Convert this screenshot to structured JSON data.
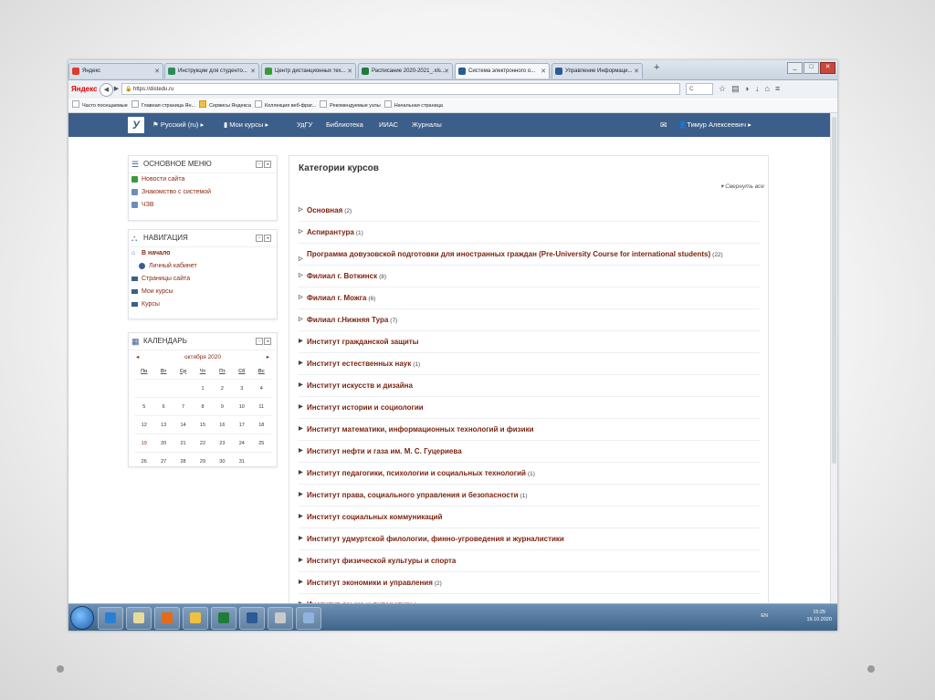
{
  "tabs": [
    {
      "label": "Яндекс",
      "fav_color": "#e03a2b",
      "active": false
    },
    {
      "label": "Инструкции для студенто...",
      "fav_color": "#2e8b57",
      "active": false
    },
    {
      "label": "Центр дистанционных тех...",
      "fav_color": "#3a9a3a",
      "active": false
    },
    {
      "label": "Расписание 2020-2021_.xls...",
      "fav_color": "#1e7d3a",
      "active": false
    },
    {
      "label": "Система электронного о...",
      "fav_color": "#2b5a95",
      "active": true
    },
    {
      "label": "Управление Информаци...",
      "fav_color": "#2b5a95",
      "active": false
    }
  ],
  "address": {
    "brand": "Яндекс",
    "url": "https://distedu.ru",
    "search_placeholder": "С"
  },
  "bookmarks": [
    {
      "label": "Часто посещаемые",
      "folder": false
    },
    {
      "label": "Главная страница Ян...",
      "folder": false
    },
    {
      "label": "Сервисы Яндекса",
      "folder": true
    },
    {
      "label": "Коллекция веб-фраг...",
      "folder": false
    },
    {
      "label": "Рекомендуемые узлы",
      "folder": false
    },
    {
      "label": "Начальная страница",
      "folder": false
    }
  ],
  "topnav": {
    "logo": "У",
    "language": "Русский (ru)",
    "my_courses": "Мои курсы",
    "links": [
      "УдГУ",
      "Библиотека",
      "ИИАС",
      "Журналы"
    ],
    "user": "Тимур Алексеевич"
  },
  "main_menu": {
    "title": "ОСНОВНОЕ МЕНЮ",
    "items": [
      "Новости сайта",
      "Знакомство с системой",
      "ЧЗВ"
    ]
  },
  "navigation": {
    "title": "НАВИГАЦИЯ",
    "items": [
      {
        "label": "В начало",
        "bold": true
      },
      {
        "label": "Личный кабинет",
        "bold": false
      },
      {
        "label": "Страницы сайта",
        "bold": false
      },
      {
        "label": "Мои курсы",
        "bold": false
      },
      {
        "label": "Курсы",
        "bold": false
      }
    ]
  },
  "calendar": {
    "title": "КАЛЕНДАРЬ",
    "month": "октября 2020",
    "weekdays": [
      "Пн",
      "Вт",
      "Ср",
      "Чт",
      "Пт",
      "Сб",
      "Вс"
    ],
    "weeks": [
      [
        "",
        "",
        "",
        "1",
        "2",
        "3",
        "4"
      ],
      [
        "5",
        "6",
        "7",
        "8",
        "9",
        "10",
        "11"
      ],
      [
        "12",
        "13",
        "14",
        "15",
        "16",
        "17",
        "18"
      ],
      [
        "19",
        "20",
        "21",
        "22",
        "23",
        "24",
        "25"
      ],
      [
        "26",
        "27",
        "28",
        "29",
        "30",
        "31",
        ""
      ]
    ]
  },
  "categories": {
    "title": "Категории курсов",
    "collapse_label": "Свернуть все",
    "items": [
      {
        "name": "Основная",
        "count": "(2)"
      },
      {
        "name": "Аспирантура",
        "count": "(1)"
      },
      {
        "name": "Программа довузовской подготовки для иностранных граждан (Pre-University Course for international students)",
        "count": "(22)"
      },
      {
        "name": "Филиал г. Воткинск",
        "count": "(8)"
      },
      {
        "name": "Филиал г. Можга",
        "count": "(6)"
      },
      {
        "name": "Филиал г.Нижняя Тура",
        "count": "(7)"
      },
      {
        "name": "Институт гражданской защиты",
        "count": ""
      },
      {
        "name": "Институт естественных наук",
        "count": "(1)"
      },
      {
        "name": "Институт искусств и дизайна",
        "count": ""
      },
      {
        "name": "Институт истории и социологии",
        "count": ""
      },
      {
        "name": "Институт математики, информационных технологий и физики",
        "count": ""
      },
      {
        "name": "Институт нефти и газа им. М. С. Гуцериева",
        "count": ""
      },
      {
        "name": "Институт педагогики, психологии и социальных технологий",
        "count": "(1)"
      },
      {
        "name": "Институт права, социального управления и безопасности",
        "count": "(1)"
      },
      {
        "name": "Институт социальных коммуникаций",
        "count": ""
      },
      {
        "name": "Институт удмуртской филологии, финно-угроведения и журналистики",
        "count": ""
      },
      {
        "name": "Институт физической культуры и спорта",
        "count": ""
      },
      {
        "name": "Институт экономики и управления",
        "count": "(2)"
      },
      {
        "name": "Институт языка и литературы",
        "count": ""
      }
    ]
  },
  "taskbar": {
    "apps": [
      {
        "name": "ie-icon",
        "color": "#2a7fd4"
      },
      {
        "name": "notes-icon",
        "color": "#e8dc9a"
      },
      {
        "name": "firefox-icon",
        "color": "#e36b1a"
      },
      {
        "name": "folder-icon",
        "color": "#f0c040"
      },
      {
        "name": "excel-icon",
        "color": "#1e7d3a"
      },
      {
        "name": "word-icon",
        "color": "#2b5a95"
      },
      {
        "name": "app-icon",
        "color": "#c9c9c9"
      },
      {
        "name": "moodle-app-icon",
        "color": "#8fb3dc"
      }
    ],
    "language": "EN",
    "time": "15:25",
    "date": "19.10.2020"
  }
}
